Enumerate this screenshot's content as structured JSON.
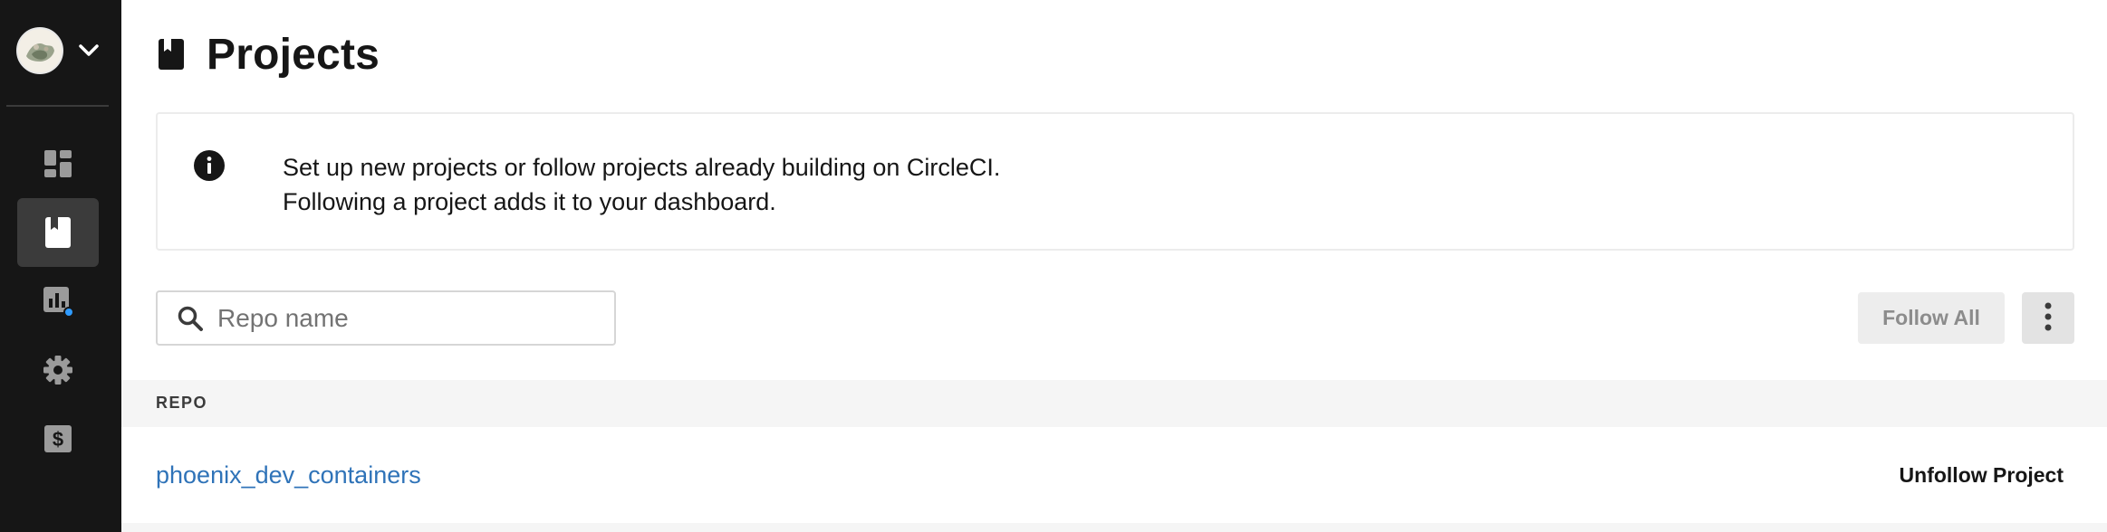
{
  "sidebar": {
    "org_switcher": {
      "avatar_icon": "org-avatar",
      "chevron_icon": "chevron-down-icon"
    },
    "items": [
      {
        "name": "dashboard",
        "icon": "dashboard-icon",
        "active": false
      },
      {
        "name": "projects",
        "icon": "projects-book-icon",
        "active": true
      },
      {
        "name": "insights",
        "icon": "insights-chart-icon",
        "active": false,
        "badge_color": "#2f9bff"
      },
      {
        "name": "settings",
        "icon": "gear-icon",
        "active": false
      },
      {
        "name": "plan",
        "icon": "dollar-icon",
        "active": false
      }
    ]
  },
  "header": {
    "title": "Projects",
    "icon": "projects-book-icon"
  },
  "info": {
    "icon": "info-icon",
    "line1": "Set up new projects or follow projects already building on CircleCI.",
    "line2": "Following a project adds it to your dashboard."
  },
  "search": {
    "placeholder": "Repo name",
    "value": "",
    "icon": "search-icon"
  },
  "toolbar": {
    "follow_all_label": "Follow All",
    "more_icon": "more-vertical-icon"
  },
  "table": {
    "columns": [
      "REPO"
    ],
    "rows": [
      {
        "repo": "phoenix_dev_containers",
        "action": "Unfollow Project"
      }
    ]
  },
  "colors": {
    "sidebar_bg": "#161616",
    "sidebar_active": "#3b3b3b",
    "link": "#2f73b8",
    "badge": "#2f9bff"
  }
}
